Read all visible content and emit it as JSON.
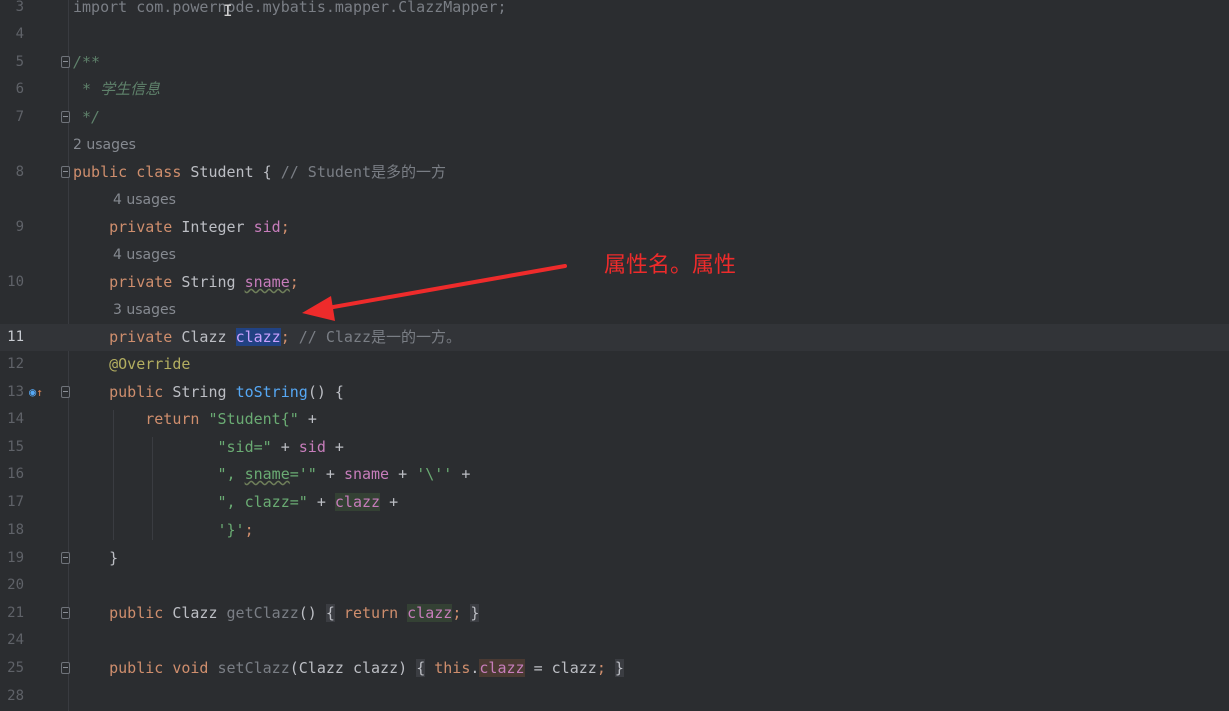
{
  "editor": {
    "lines": [
      {
        "num": "3",
        "tokens": [
          {
            "t": "import com.powernode.mybatis.mapper.ClazzMapper;",
            "c": "cmt"
          }
        ]
      },
      {
        "num": "4",
        "tokens": []
      },
      {
        "num": "5",
        "tokens": [
          {
            "t": "/**",
            "c": "doc"
          }
        ]
      },
      {
        "num": "6",
        "tokens": [
          {
            "t": " * 学生信息",
            "c": "doc"
          }
        ]
      },
      {
        "num": "7",
        "tokens": [
          {
            "t": " */",
            "c": "doc"
          }
        ]
      },
      {
        "num": "8",
        "usages": "2 usages",
        "tokens": [
          {
            "t": "public ",
            "c": "kw"
          },
          {
            "t": "class ",
            "c": "kw"
          },
          {
            "t": "Student ",
            "c": "cls"
          },
          {
            "t": "{ ",
            "c": "plain"
          },
          {
            "t": "// Student是多的一方",
            "c": "cmt"
          }
        ]
      },
      {
        "num": "9",
        "usages": "4 usages",
        "tokens": [
          {
            "t": "    private ",
            "c": "kw"
          },
          {
            "t": "Integer ",
            "c": "cls"
          },
          {
            "t": "sid",
            "c": "fld"
          },
          {
            "t": ";",
            "c": "kw"
          }
        ]
      },
      {
        "num": "10",
        "usages": "4 usages",
        "tokens": [
          {
            "t": "    private ",
            "c": "kw"
          },
          {
            "t": "String ",
            "c": "cls"
          },
          {
            "t": "sname",
            "c": "fld squig"
          },
          {
            "t": ";",
            "c": "kw"
          }
        ]
      },
      {
        "num": "11",
        "usages": "3 usages",
        "current": true,
        "tokens": [
          {
            "t": "    private ",
            "c": "kw"
          },
          {
            "t": "Clazz ",
            "c": "cls"
          },
          {
            "t": "clazz",
            "c": "sel"
          },
          {
            "t": "; ",
            "c": "kw"
          },
          {
            "t": "// Clazz是一的一方。",
            "c": "cmt"
          }
        ]
      },
      {
        "num": "12",
        "tokens": [
          {
            "t": "    @Override",
            "c": "ann"
          }
        ]
      },
      {
        "num": "13",
        "tokens": [
          {
            "t": "    public ",
            "c": "kw"
          },
          {
            "t": "String ",
            "c": "cls"
          },
          {
            "t": "toString",
            "c": "mth"
          },
          {
            "t": "() {",
            "c": "plain"
          }
        ]
      },
      {
        "num": "14",
        "tokens": [
          {
            "t": "        return ",
            "c": "kw"
          },
          {
            "t": "\"Student{\" ",
            "c": "str"
          },
          {
            "t": "+",
            "c": "plain"
          }
        ]
      },
      {
        "num": "15",
        "tokens": [
          {
            "t": "                ",
            "c": "plain"
          },
          {
            "t": "\"sid=\" ",
            "c": "str"
          },
          {
            "t": "+ ",
            "c": "plain"
          },
          {
            "t": "sid ",
            "c": "fld"
          },
          {
            "t": "+",
            "c": "plain"
          }
        ]
      },
      {
        "num": "16",
        "tokens": [
          {
            "t": "                ",
            "c": "plain"
          },
          {
            "t": "\", ",
            "c": "str"
          },
          {
            "t": "sname",
            "c": "str squig"
          },
          {
            "t": "='\" ",
            "c": "str"
          },
          {
            "t": "+ ",
            "c": "plain"
          },
          {
            "t": "sname ",
            "c": "fld"
          },
          {
            "t": "+ ",
            "c": "plain"
          },
          {
            "t": "'\\'' ",
            "c": "str"
          },
          {
            "t": "+",
            "c": "plain"
          }
        ]
      },
      {
        "num": "17",
        "tokens": [
          {
            "t": "                ",
            "c": "plain"
          },
          {
            "t": "\", clazz=\" ",
            "c": "str"
          },
          {
            "t": "+ ",
            "c": "plain"
          },
          {
            "t": "clazz",
            "c": "fld hl"
          },
          {
            "t": " +",
            "c": "plain"
          }
        ]
      },
      {
        "num": "18",
        "tokens": [
          {
            "t": "                ",
            "c": "plain"
          },
          {
            "t": "'}'",
            "c": "str"
          },
          {
            "t": ";",
            "c": "kw"
          }
        ]
      },
      {
        "num": "19",
        "tokens": [
          {
            "t": "    }",
            "c": "plain"
          }
        ]
      },
      {
        "num": "20",
        "tokens": []
      },
      {
        "num": "21",
        "tokens": [
          {
            "t": "    public ",
            "c": "kw"
          },
          {
            "t": "Clazz ",
            "c": "cls"
          },
          {
            "t": "getClazz",
            "c": "cmt"
          },
          {
            "t": "() ",
            "c": "plain"
          },
          {
            "t": "{",
            "c": "brk"
          },
          {
            "t": " return ",
            "c": "kw"
          },
          {
            "t": "clazz",
            "c": "fld hl"
          },
          {
            "t": ";",
            "c": "kw"
          },
          {
            "t": " ",
            "c": "plain"
          },
          {
            "t": "}",
            "c": "brk"
          }
        ]
      },
      {
        "num": "24",
        "tokens": []
      },
      {
        "num": "25",
        "tokens": [
          {
            "t": "    public ",
            "c": "kw"
          },
          {
            "t": "void ",
            "c": "kw"
          },
          {
            "t": "setClazz",
            "c": "cmt"
          },
          {
            "t": "(Clazz clazz) ",
            "c": "plain"
          },
          {
            "t": "{",
            "c": "brk"
          },
          {
            "t": " this",
            "c": "kw"
          },
          {
            "t": ".",
            "c": "plain"
          },
          {
            "t": "clazz",
            "c": "fld hlw"
          },
          {
            "t": " = clazz",
            "c": "plain"
          },
          {
            "t": ";",
            "c": "kw"
          },
          {
            "t": " ",
            "c": "plain"
          },
          {
            "t": "}",
            "c": "brk"
          }
        ]
      },
      {
        "num": "28",
        "tokens": []
      }
    ]
  },
  "annotation": {
    "text": "属性名。属性",
    "color": "#ee2b2b"
  },
  "icons": {
    "gutter_override": "override-method-icon",
    "cursor": "text-cursor-icon"
  },
  "colors": {
    "background": "#2b2d30",
    "keyword": "#cf8e6d",
    "field": "#c77dbb",
    "string": "#6aab73",
    "comment": "#7a7e85",
    "selection": "#214283"
  }
}
